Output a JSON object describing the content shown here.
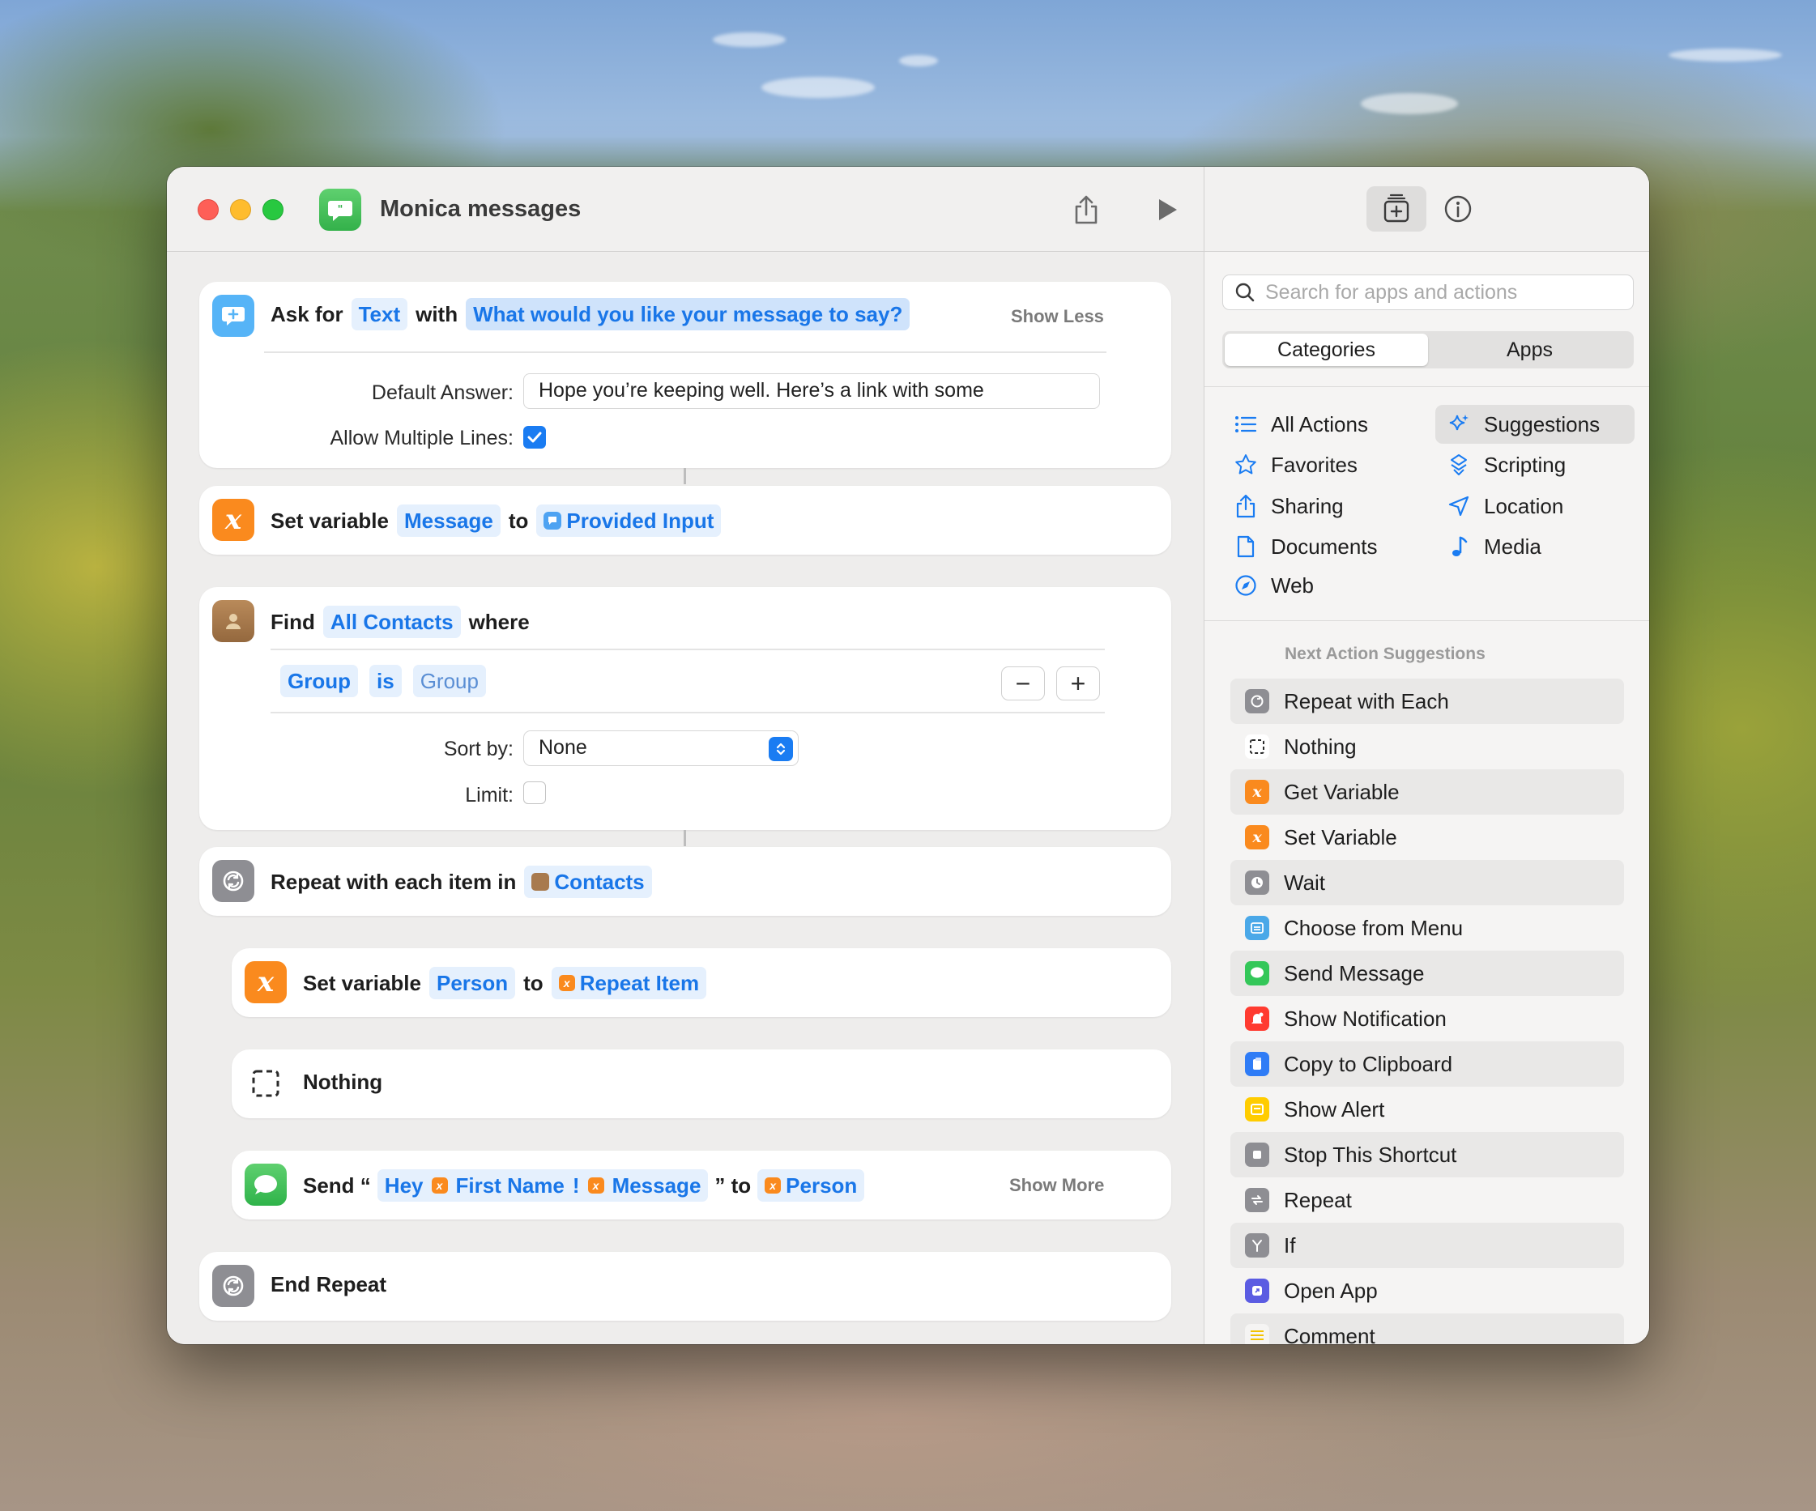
{
  "window": {
    "title": "Monica messages"
  },
  "actions": {
    "ask": {
      "prefix": "Ask for",
      "type": "Text",
      "with": "with",
      "prompt": "What would you like your message to say?",
      "toggle": "Show Less",
      "default_label": "Default Answer:",
      "default_value": "Hope you’re keeping well. Here’s a link with some",
      "multiline_label": "Allow Multiple Lines:",
      "multiline_checked": true
    },
    "set_message": {
      "prefix": "Set variable",
      "variable": "Message",
      "to": "to",
      "value": "Provided Input"
    },
    "find": {
      "prefix": "Find",
      "scope": "All Contacts",
      "where": "where",
      "filter_field": "Group",
      "filter_op": "is",
      "filter_value": "Group",
      "minus": "−",
      "plus": "+",
      "sort_label": "Sort by:",
      "sort_value": "None",
      "limit_label": "Limit:",
      "limit_checked": false
    },
    "repeat": {
      "prefix": "Repeat with each item in",
      "value": "Contacts"
    },
    "set_person": {
      "prefix": "Set variable",
      "variable": "Person",
      "to": "to",
      "value": "Repeat Item"
    },
    "nothing": {
      "label": "Nothing"
    },
    "send": {
      "prefix": "Send “",
      "hey": "Hey",
      "first_name": "First Name",
      "excl": "!",
      "message": "Message",
      "suffix": "” to",
      "recipient": "Person",
      "toggle": "Show More"
    },
    "end_repeat": {
      "label": "End Repeat"
    }
  },
  "sidebar": {
    "search_placeholder": "Search for apps and actions",
    "tabs": [
      "Categories",
      "Apps"
    ],
    "active_tab": "Categories",
    "categories": [
      {
        "label": "All Actions",
        "icon": "list-icon"
      },
      {
        "label": "Suggestions",
        "icon": "sparkle-icon",
        "active": true
      },
      {
        "label": "Favorites",
        "icon": "star-icon"
      },
      {
        "label": "Scripting",
        "icon": "scripting-icon"
      },
      {
        "label": "Sharing",
        "icon": "share-icon"
      },
      {
        "label": "Location",
        "icon": "location-arrow-icon"
      },
      {
        "label": "Documents",
        "icon": "document-icon"
      },
      {
        "label": "Media",
        "icon": "music-note-icon"
      },
      {
        "label": "Web",
        "icon": "compass-icon"
      }
    ],
    "suggestions_header": "Next Action Suggestions",
    "suggestions": [
      {
        "label": "Repeat with Each",
        "icon": "repeat-each-icon",
        "color": "#8e8e93"
      },
      {
        "label": "Nothing",
        "icon": "nothing-icon",
        "color": "#ffffff"
      },
      {
        "label": "Get Variable",
        "icon": "variable-icon",
        "color": "#fa8a1e"
      },
      {
        "label": "Set Variable",
        "icon": "variable-icon",
        "color": "#fa8a1e"
      },
      {
        "label": "Wait",
        "icon": "clock-icon",
        "color": "#8e8e93"
      },
      {
        "label": "Choose from Menu",
        "icon": "menu-icon",
        "color": "#4aa8e8"
      },
      {
        "label": "Send Message",
        "icon": "message-icon",
        "color": "#34c759"
      },
      {
        "label": "Show Notification",
        "icon": "bell-icon",
        "color": "#ff3b30"
      },
      {
        "label": "Copy to Clipboard",
        "icon": "clipboard-icon",
        "color": "#2f7cf6"
      },
      {
        "label": "Show Alert",
        "icon": "alert-icon",
        "color": "#ffcc00"
      },
      {
        "label": "Stop This Shortcut",
        "icon": "stop-icon",
        "color": "#8e8e93"
      },
      {
        "label": "Repeat",
        "icon": "repeat-icon",
        "color": "#8e8e93"
      },
      {
        "label": "If",
        "icon": "if-icon",
        "color": "#8e8e93"
      },
      {
        "label": "Open App",
        "icon": "open-app-icon",
        "color": "#5b5ce2"
      },
      {
        "label": "Comment",
        "icon": "comment-icon",
        "color": "#f5f4f3"
      }
    ]
  }
}
